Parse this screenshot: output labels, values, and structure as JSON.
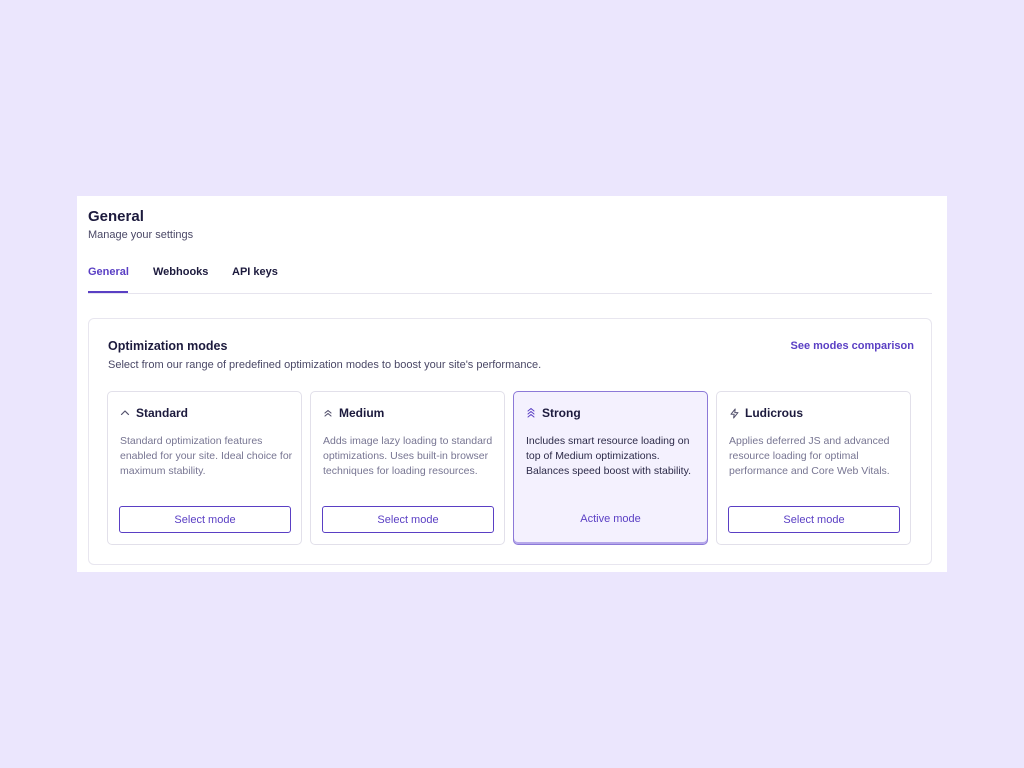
{
  "header": {
    "title": "General",
    "subtitle": "Manage your settings"
  },
  "tabs": [
    {
      "label": "General",
      "active": true
    },
    {
      "label": "Webhooks",
      "active": false
    },
    {
      "label": "API keys",
      "active": false
    }
  ],
  "optimization": {
    "title": "Optimization modes",
    "description": "Select from our range of predefined optimization modes to boost your site's performance.",
    "comparison_link": "See modes comparison",
    "modes": [
      {
        "name": "Standard",
        "icon": "chevron-up-icon",
        "description": "Standard optimization features enabled for your site. Ideal choice for maximum stability.",
        "button": "Select mode",
        "active": false
      },
      {
        "name": "Medium",
        "icon": "double-chevron-up-icon",
        "description": "Adds image lazy loading to standard optimizations. Uses built-in browser techniques for loading resources.",
        "button": "Select mode",
        "active": false
      },
      {
        "name": "Strong",
        "icon": "triple-chevron-up-icon",
        "description": "Includes smart resource loading on top of Medium optimizations. Balances speed boost with stability.",
        "button": "Active mode",
        "active": true
      },
      {
        "name": "Ludicrous",
        "icon": "lightning-bolt-icon",
        "description": "Applies deferred JS and advanced resource loading for optimal performance and Core Web Vitals.",
        "button": "Select mode",
        "active": false
      }
    ]
  },
  "colors": {
    "background": "#ebe6fd",
    "accent": "#5a3fc4",
    "active_card_bg": "#f4f1fe"
  }
}
